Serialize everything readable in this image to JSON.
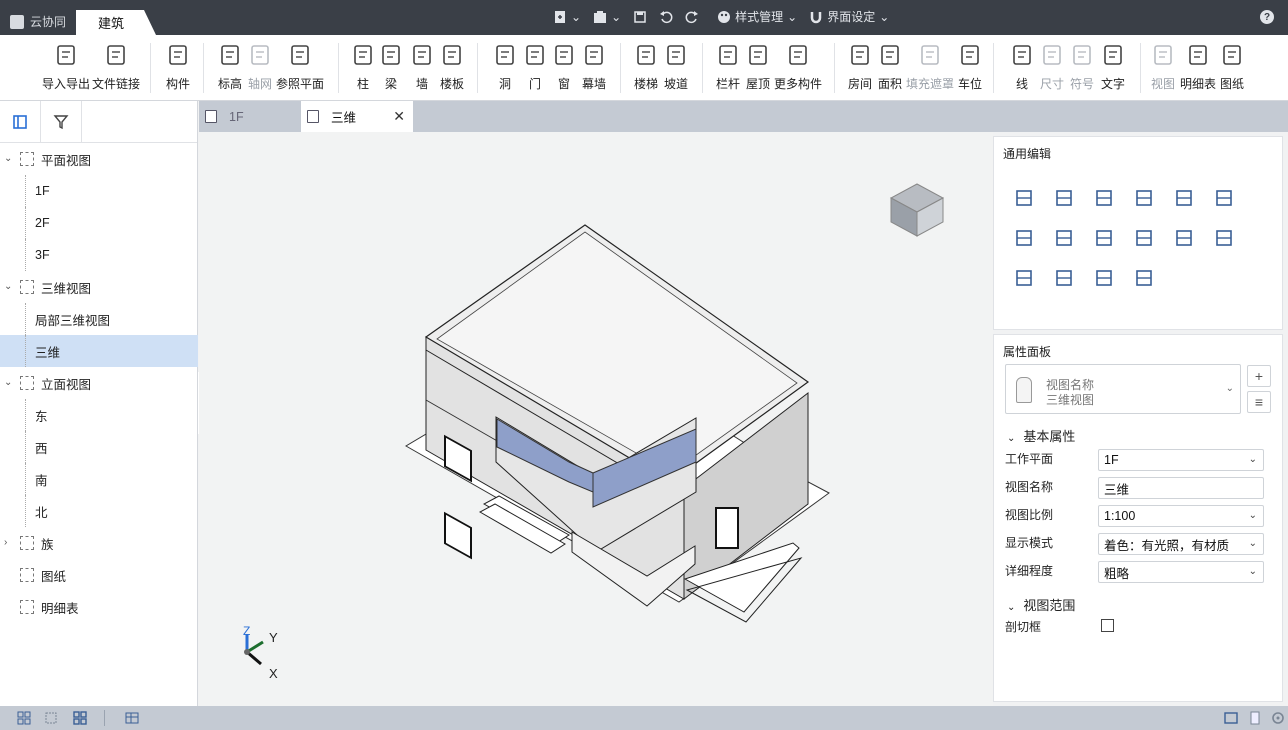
{
  "titlebar": {
    "app_tab": "云协同",
    "main_tab": "建筑",
    "style_menu": "样式管理",
    "ui_menu": "界面设定",
    "help": "?"
  },
  "ribbon": {
    "items": [
      {
        "label": "导入导出",
        "icon": "cad-icon",
        "disabled": false
      },
      {
        "label": "文件链接",
        "icon": "file-link-icon",
        "disabled": false
      },
      {
        "label": "构件",
        "icon": "component-icon",
        "disabled": false
      },
      {
        "label": "标高",
        "icon": "level-icon",
        "disabled": false
      },
      {
        "label": "轴网",
        "icon": "grid-icon",
        "disabled": true
      },
      {
        "label": "参照平面",
        "icon": "ref-plane-icon",
        "disabled": false
      },
      {
        "label": "柱",
        "icon": "column-icon",
        "disabled": false
      },
      {
        "label": "梁",
        "icon": "beam-icon",
        "disabled": false
      },
      {
        "label": "墙",
        "icon": "wall-icon",
        "disabled": false
      },
      {
        "label": "楼板",
        "icon": "slab-icon",
        "disabled": false
      },
      {
        "label": "洞",
        "icon": "opening-icon",
        "disabled": false
      },
      {
        "label": "门",
        "icon": "door-icon",
        "disabled": false
      },
      {
        "label": "窗",
        "icon": "window-icon",
        "disabled": false
      },
      {
        "label": "幕墙",
        "icon": "curtain-wall-icon",
        "disabled": false
      },
      {
        "label": "楼梯",
        "icon": "stair-icon",
        "disabled": false
      },
      {
        "label": "坡道",
        "icon": "ramp-icon",
        "disabled": false
      },
      {
        "label": "栏杆",
        "icon": "railing-icon",
        "disabled": false
      },
      {
        "label": "屋顶",
        "icon": "roof-icon",
        "disabled": false
      },
      {
        "label": "更多构件",
        "icon": "more-components-icon",
        "disabled": false
      },
      {
        "label": "房间",
        "icon": "room-icon",
        "disabled": false
      },
      {
        "label": "面积",
        "icon": "area-icon",
        "disabled": false
      },
      {
        "label": "填充遮罩",
        "icon": "fill-mask-icon",
        "disabled": true
      },
      {
        "label": "车位",
        "icon": "parking-icon",
        "disabled": false
      },
      {
        "label": "线",
        "icon": "line-icon",
        "disabled": false
      },
      {
        "label": "尺寸",
        "icon": "dimension-icon",
        "disabled": true
      },
      {
        "label": "符号",
        "icon": "symbol-icon",
        "disabled": true
      },
      {
        "label": "文字",
        "icon": "text-icon",
        "disabled": false
      },
      {
        "label": "视图",
        "icon": "view-icon",
        "disabled": true
      },
      {
        "label": "明细表",
        "icon": "schedule-icon",
        "disabled": false
      },
      {
        "label": "图纸",
        "icon": "sheet-icon",
        "disabled": false
      }
    ]
  },
  "tree": {
    "items": [
      {
        "label": "平面视图",
        "level": 0,
        "expander": "open"
      },
      {
        "label": "1F",
        "level": 1
      },
      {
        "label": "2F",
        "level": 1
      },
      {
        "label": "3F",
        "level": 1
      },
      {
        "label": "三维视图",
        "level": 0,
        "expander": "open"
      },
      {
        "label": "局部三维视图",
        "level": 1
      },
      {
        "label": "三维",
        "level": 1,
        "selected": true
      },
      {
        "label": "立面视图",
        "level": 0,
        "expander": "open"
      },
      {
        "label": "东",
        "level": 1
      },
      {
        "label": "西",
        "level": 1
      },
      {
        "label": "南",
        "level": 1
      },
      {
        "label": "北",
        "level": 1
      },
      {
        "label": "族",
        "level": 0,
        "expander": "closed"
      },
      {
        "label": "图纸",
        "level": 0
      },
      {
        "label": "明细表",
        "level": 0
      }
    ]
  },
  "doctabs": {
    "tab1": "1F",
    "tab2": "三维"
  },
  "viewport": {
    "axis_z": "Z",
    "axis_y": "Y",
    "axis_x": "X"
  },
  "edit_panel": {
    "title": "通用编辑"
  },
  "props": {
    "title": "属性面板",
    "type_line1": "视图名称",
    "type_line2": "三维视图",
    "section_basic": "基本属性",
    "section_range": "视图范围",
    "rows": [
      {
        "label": "工作平面",
        "value": "1F",
        "dropdown": true
      },
      {
        "label": "视图名称",
        "value": "三维",
        "dropdown": false
      },
      {
        "label": "视图比例",
        "value": "1:100",
        "dropdown": true
      },
      {
        "label": "显示模式",
        "value": "着色：有光照，有材质",
        "dropdown": true
      },
      {
        "label": "详细程度",
        "value": "粗略",
        "dropdown": true
      }
    ],
    "section_box_label": "剖切框",
    "section_box_checked": false
  },
  "colors": {
    "titlebar": "#3a3f47",
    "selection": "#cfe0f5",
    "tabbar": "#c4cad3",
    "glass": "#8e9fc9"
  }
}
